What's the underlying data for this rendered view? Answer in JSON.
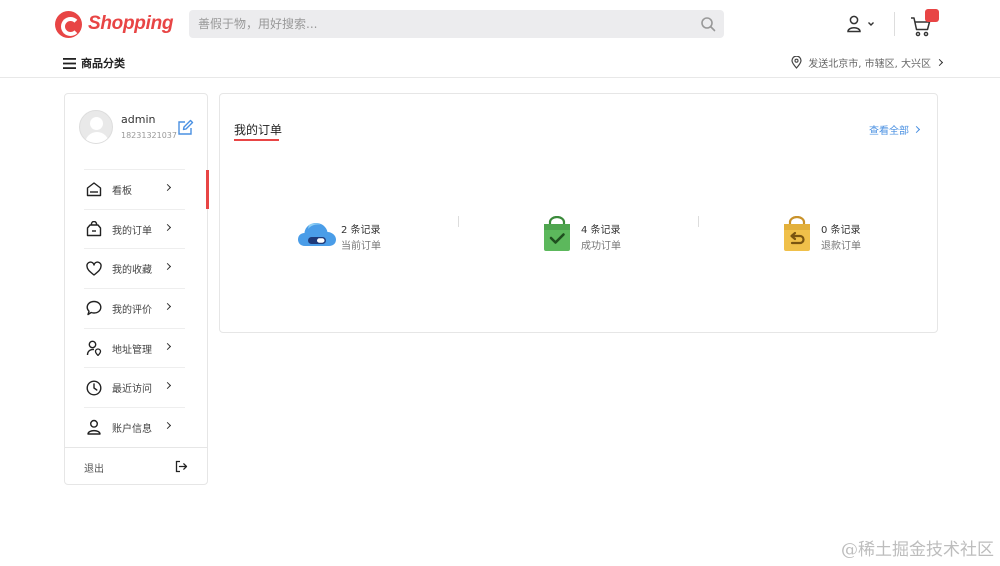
{
  "brand": {
    "name": "Shopping",
    "color": "#e84545"
  },
  "search": {
    "placeholder": "善假于物，用好搜索..."
  },
  "subbar": {
    "categories_label": "商品分类",
    "location": "发送北京市, 市辖区, 大兴区"
  },
  "profile": {
    "username": "admin",
    "phone": "18231321037"
  },
  "sidebar": {
    "items": [
      {
        "label": "看板",
        "icon": "dashboard-icon",
        "active": true
      },
      {
        "label": "我的订单",
        "icon": "order-bag-icon",
        "active": false
      },
      {
        "label": "我的收藏",
        "icon": "heart-icon",
        "active": false
      },
      {
        "label": "我的评价",
        "icon": "comment-icon",
        "active": false
      },
      {
        "label": "地址管理",
        "icon": "address-icon",
        "active": false
      },
      {
        "label": "最近访问",
        "icon": "clock-icon",
        "active": false
      },
      {
        "label": "账户信息",
        "icon": "user-icon",
        "active": false
      }
    ],
    "logout_label": "退出"
  },
  "orders": {
    "title": "我的订单",
    "view_all": "查看全部",
    "stats": [
      {
        "count": "2 条记录",
        "label": "当前订单",
        "icon": "cloud-toggle-icon"
      },
      {
        "count": "4 条记录",
        "label": "成功订单",
        "icon": "green-bag-check-icon"
      },
      {
        "count": "0 条记录",
        "label": "退款订单",
        "icon": "yellow-bag-return-icon"
      }
    ]
  },
  "watermark": "@稀土掘金技术社区",
  "colors": {
    "accent": "#e84545",
    "link": "#4a90e2"
  }
}
